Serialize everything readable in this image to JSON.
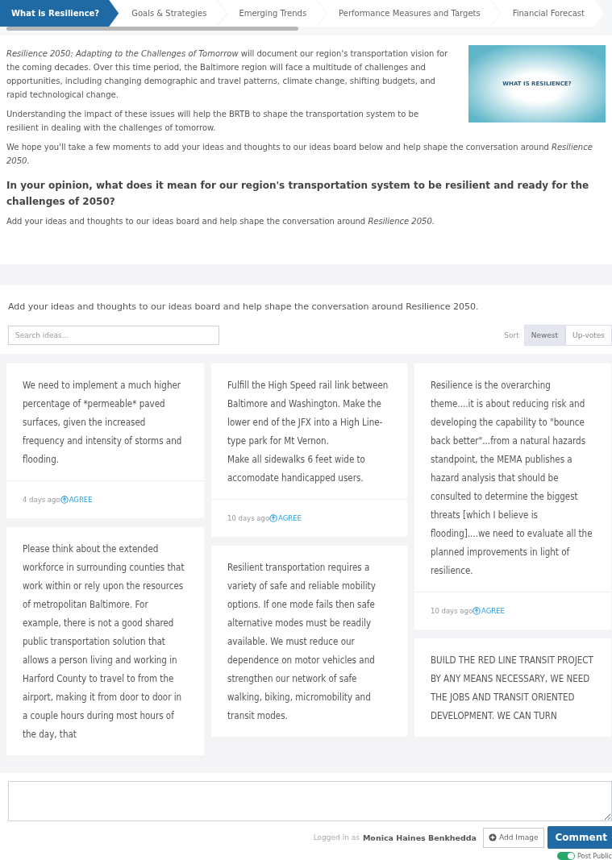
{
  "tabs": [
    {
      "label": "What is Resilience?",
      "selected": true
    },
    {
      "label": "Goals & Strategies",
      "selected": false
    },
    {
      "label": "Emerging Trends",
      "selected": false
    },
    {
      "label": "Performance Measures and Targets",
      "selected": false
    },
    {
      "label": "Financial Forecast",
      "selected": false
    }
  ],
  "intro": {
    "paragraphs": [
      "*Resilience 2050: Adapting to the Challenges of Tomorrow* will document our region's transportation vision for the coming decades. Over this time period, the Baltimore region will face a multitude of challenges and opportunities, including changing demographic and travel patterns, climate change, shifting budgets, and rapid technological change.",
      "Understanding the impact of these issues will help the BRTB to shape the transportation system to be resilient in dealing with the challenges of tomorrow.",
      "We hope you'll take a few moments to add your ideas and thoughts to our ideas board below and help shape the conversation around *Resilience 2050.*"
    ],
    "image_label": "WHAT IS RESILIENCE?",
    "question": "In your opinion, what does it mean for our region's transportation system to be resilient and ready for the challenges of 2050?",
    "prompt": "Add your ideas and thoughts to our ideas board and help shape the conversation around *Resilience 2050.*"
  },
  "board": {
    "heading": "Add your ideas and thoughts to our ideas board and help shape the conversation around Resilience 2050.",
    "search": {
      "placeholder": "Search ideas..."
    },
    "sort_label": "Sort",
    "sort_options": [
      {
        "label": "Newest",
        "selected": true
      },
      {
        "label": "Up-votes",
        "selected": false
      }
    ],
    "columns": [
      [
        {
          "text": "We need to implement a much higher percentage of *permeable* paved surfaces, given the increased frequency and intensity of storms and flooding.",
          "age": "4 days ago",
          "agree": "AGREE"
        },
        {
          "text": "Please think about the extended workforce in surrounding counties that work within or rely upon the resources of metropolitan Baltimore. For example, there is not a good shared public transportation solution that allows a person living and working in Harford County to travel to from the airport, making it from door to door in a couple hours during most hours of the day, that"
        }
      ],
      [
        {
          "text": "Fulfill the High Speed rail link between Baltimore and Washington. Make the lower end of the JFX into a High Line-type park for Mt Vernon.\nMake all sidewalks 6 feet wide to accomodate handicapped users.",
          "age": "10 days ago",
          "agree": "AGREE"
        },
        {
          "text": "Resilient transportation requires a variety of safe and reliable mobility options. If one mode fails then safe alternative modes must be readily available. We must reduce our dependence on motor vehicles and strengthen our network of safe walking, biking, micromobility and transit modes."
        }
      ],
      [
        {
          "text": "Resilience is the overarching theme....it is about reducing risk and developing the capability to \"bounce back better\"...from a natural hazards standpoint, the MEMA publishes a hazard analysis that should be consulted to determine the biggest threats [which I believe is flooding]....we need to evaluate all the planned improvements in light of resilience.",
          "age": "10 days ago",
          "agree": "AGREE"
        },
        {
          "text": "BUILD THE RED LINE TRANSIT PROJECT BY ANY MEANS NECESSARY, WE NEED THE JOBS AND TRANSIT ORIENTED DEVELOPMENT. WE CAN TURN"
        }
      ]
    ]
  },
  "comment": {
    "logged_in_label": "Logged in as",
    "user": "Monica Haines Benkhedda",
    "add_image": "Add Image",
    "submit": "Comment",
    "post_publicly": {
      "label": "Post Public",
      "on": true
    }
  }
}
